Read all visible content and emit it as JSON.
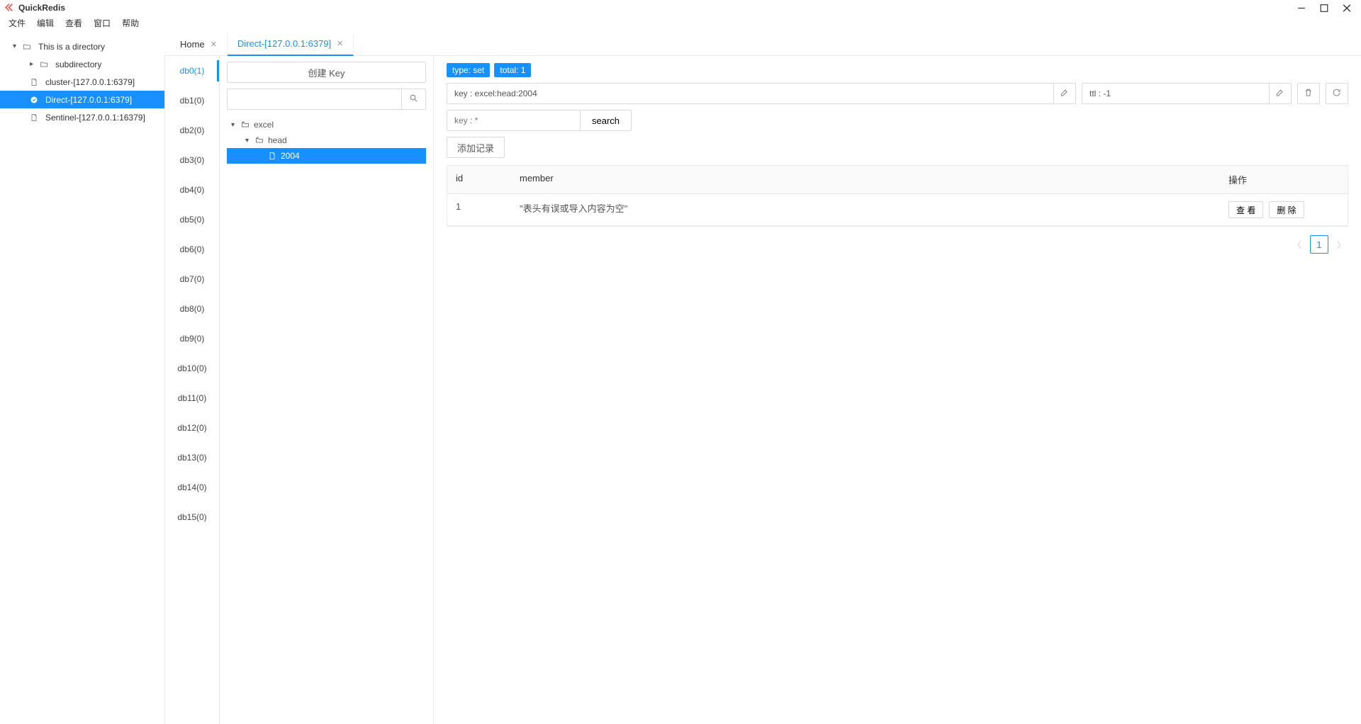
{
  "app": {
    "title": "QuickRedis"
  },
  "menubar": [
    "文件",
    "编辑",
    "查看",
    "窗口",
    "帮助"
  ],
  "connections": {
    "root": {
      "label": "This is a directory"
    },
    "sub": {
      "label": "subdirectory"
    },
    "items": [
      {
        "label": "cluster-[127.0.0.1:6379]",
        "selected": false
      },
      {
        "label": "Direct-[127.0.0.1:6379]",
        "selected": true
      },
      {
        "label": "Sentinel-[127.0.0.1:16379]",
        "selected": false
      }
    ]
  },
  "tabs": [
    {
      "label": "Home",
      "active": false
    },
    {
      "label": "Direct-[127.0.0.1:6379]",
      "active": true
    }
  ],
  "dbs": [
    {
      "label": "db0(1)",
      "active": true
    },
    {
      "label": "db1(0)"
    },
    {
      "label": "db2(0)"
    },
    {
      "label": "db3(0)"
    },
    {
      "label": "db4(0)"
    },
    {
      "label": "db5(0)"
    },
    {
      "label": "db6(0)"
    },
    {
      "label": "db7(0)"
    },
    {
      "label": "db8(0)"
    },
    {
      "label": "db9(0)"
    },
    {
      "label": "db10(0)"
    },
    {
      "label": "db11(0)"
    },
    {
      "label": "db12(0)"
    },
    {
      "label": "db13(0)"
    },
    {
      "label": "db14(0)"
    },
    {
      "label": "db15(0)"
    }
  ],
  "keypanel": {
    "create_btn": "创建 Key",
    "search_placeholder": "",
    "tree": {
      "l0": "excel",
      "l1": "head",
      "l2": "2004"
    }
  },
  "valuepanel": {
    "type_badge": "type: set",
    "total_badge": "total: 1",
    "key_input": "key : excel:head:2004",
    "ttl_input": "ttl : -1",
    "filter_placeholder": "key : *",
    "search_btn": "search",
    "add_record_btn": "添加记录",
    "table": {
      "headers": {
        "id": "id",
        "member": "member",
        "actions": "操作"
      },
      "rows": [
        {
          "id": "1",
          "member": "\"表头有误或导入内容为空\""
        }
      ],
      "action_view": "查 看",
      "action_delete": "删 除"
    },
    "pagination": {
      "current": "1"
    }
  }
}
